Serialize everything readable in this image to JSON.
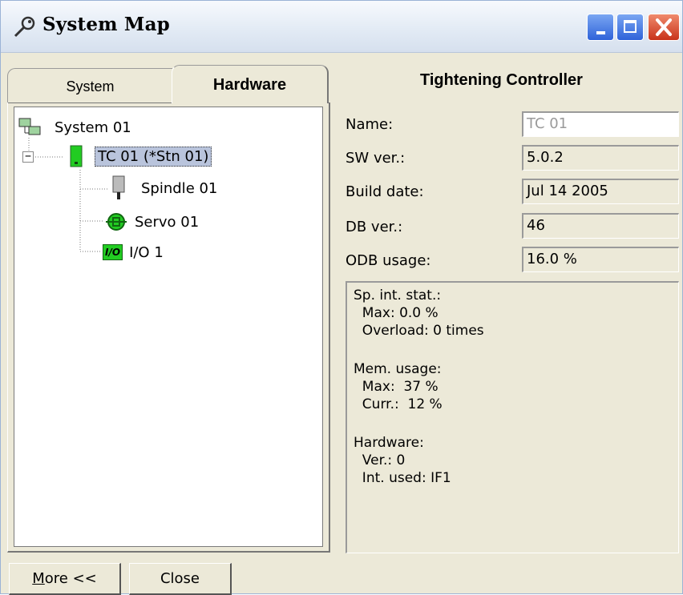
{
  "window": {
    "title": "System Map",
    "icon": "wrench-icon",
    "controls": [
      "minimize-icon",
      "maximize-icon",
      "close-icon"
    ]
  },
  "tabs": [
    {
      "label": "System",
      "selected": false
    },
    {
      "label": "Hardware",
      "selected": true
    }
  ],
  "tree": {
    "items": [
      {
        "label": "System 01",
        "icon": "system-icon",
        "level": 0
      },
      {
        "label": "TC 01 (*Stn 01)",
        "icon": "controller-icon",
        "level": 1,
        "selected": true,
        "expanded": true,
        "expander": "⊟"
      },
      {
        "label": "Spindle 01",
        "icon": "spindle-icon",
        "level": 2
      },
      {
        "label": "Servo 01",
        "icon": "servo-icon",
        "level": 2
      },
      {
        "label": "I/O 1",
        "icon": "io-icon",
        "level": 2,
        "icon_text": "I/O"
      }
    ]
  },
  "details": {
    "title": "Tightening Controller",
    "fields": [
      {
        "label": "Name:",
        "value": "TC 01",
        "editable": true
      },
      {
        "label": "SW ver.:",
        "value": "5.0.2",
        "editable": false
      },
      {
        "label": "Build date:",
        "value": "Jul 14 2005",
        "editable": false
      },
      {
        "label": "DB ver.:",
        "value": "46",
        "editable": false
      },
      {
        "label": "ODB usage:",
        "value": "16.0 %",
        "editable": false
      }
    ],
    "info_lines": [
      "Sp. int. stat.:",
      "  Max: 0.0 %",
      "  Overload: 0 times",
      "Mem. usage:",
      "  Max:  37 %",
      "  Curr.:  12 %",
      "Hardware:",
      "  Ver.: 0",
      "  Int. used: IF1"
    ]
  },
  "buttons": {
    "more_mnemonic": "M",
    "more_rest": "ore <<",
    "close": "Close"
  },
  "colors": {
    "window_bg": "#ece9d8",
    "titlebar": "#e3ebf5",
    "close_button": "#c8331a",
    "device_green": "#22cc22",
    "selection": "#b9c4dc"
  }
}
